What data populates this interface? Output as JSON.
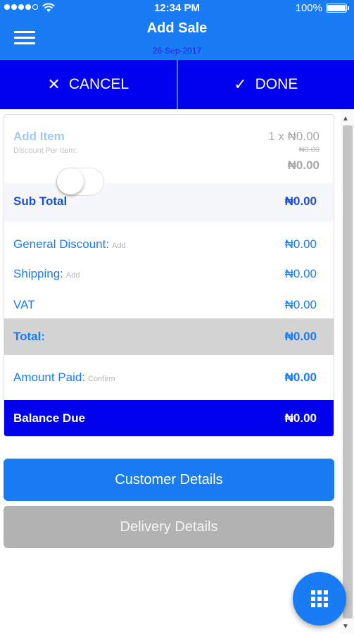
{
  "status_bar": {
    "time": "12:34 PM",
    "battery": "100%"
  },
  "header": {
    "title": "Add Sale",
    "date": "26-Sep-2017"
  },
  "actions": {
    "cancel_label": "CANCEL",
    "done_label": "DONE"
  },
  "item": {
    "label": "Add Item",
    "discount_label": "Discount Per Item:",
    "qty_price": "1 x ₦0.00",
    "discount_value": "₦0.00",
    "total": "₦0.00"
  },
  "summary": {
    "subtotal_label": "Sub Total",
    "subtotal_value": "₦0.00",
    "general_discount_label": "General Discount:",
    "general_discount_link": "Add",
    "general_discount_value": "₦0.00",
    "shipping_label": "Shipping:",
    "shipping_link": "Add",
    "shipping_value": "₦0.00",
    "vat_label": "VAT",
    "vat_enabled": false,
    "vat_value": "₦0.00",
    "total_label": "Total:",
    "total_value": "₦0.00",
    "amount_paid_label": "Amount Paid:",
    "amount_paid_link": "Confirm",
    "amount_paid_value": "₦0.00",
    "balance_label": "Balance Due",
    "balance_value": "₦0.00"
  },
  "buttons": {
    "customer_details": "Customer Details",
    "delivery_details": "Delivery Details"
  },
  "colors": {
    "primary": "#1a7cf5",
    "action_bar": "#0000ee",
    "total_row": "#d3d3d3",
    "disabled_button": "#b2b2b2"
  },
  "icons": {
    "menu": "hamburger-icon",
    "cancel": "close-icon",
    "done": "checkmark-icon",
    "fab": "grid-icon"
  }
}
